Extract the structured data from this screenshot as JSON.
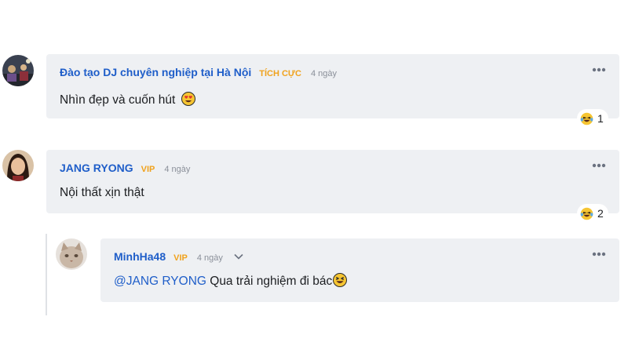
{
  "comments": [
    {
      "author": "Đào tạo DJ chuyên nghiệp tại Hà Nội",
      "badge": "TÍCH CỰC",
      "time": "4 ngày",
      "text": "Nhìn đẹp và cuốn hút",
      "emoji": "heart-eyes-emoji",
      "reaction": {
        "icon": "laughing-tears-icon",
        "count": "1"
      }
    },
    {
      "author": "JANG RYONG",
      "badge": "VIP",
      "time": "4 ngày",
      "text": "Nội thất xịn thật",
      "reaction": {
        "icon": "laughing-tears-icon",
        "count": "2"
      }
    }
  ],
  "reply": {
    "author": "MinhHa48",
    "badge": "VIP",
    "time": "4 ngày",
    "mention": "@JANG RYONG",
    "text": " Qua trải nghiệm đi bác",
    "emoji": "squinting-laugh-emoji"
  },
  "colors": {
    "author": "#1f5ec9",
    "badge": "#f0a21d",
    "bubble": "#eef0f3",
    "muted": "#8a8f99"
  }
}
